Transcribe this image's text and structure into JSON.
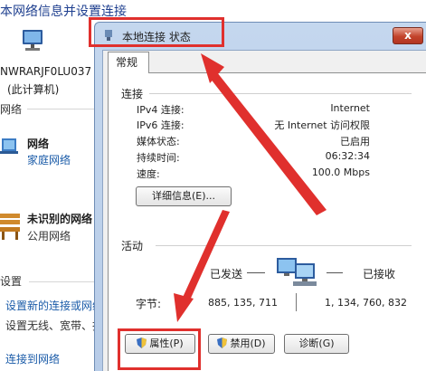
{
  "background": {
    "title": "本网络信息并设置连接",
    "computer_name": "NWRARJF0LU037",
    "computer_sub": "(此计算机)",
    "section_network": "网络",
    "networks": [
      {
        "name": "网络",
        "type_link": "家庭网络"
      },
      {
        "name": "未识别的网络",
        "type_text": "公用网络"
      }
    ],
    "section_settings": "设置",
    "links": [
      "设置新的连接或网络",
      "设置无线、宽带、拨",
      "连接到网络"
    ]
  },
  "dialog": {
    "title": "本地连接 状态",
    "close_label": "x",
    "tab": "常规",
    "connection": {
      "group_title": "连接",
      "rows": [
        {
          "label": "IPv4 连接:",
          "value": "Internet"
        },
        {
          "label": "IPv6 连接:",
          "value": "无 Internet 访问权限"
        },
        {
          "label": "媒体状态:",
          "value": "已启用"
        },
        {
          "label": "持续时间:",
          "value": "06:32:34"
        },
        {
          "label": "速度:",
          "value": "100.0 Mbps"
        }
      ],
      "details_button": "详细信息(E)..."
    },
    "activity": {
      "group_title": "活动",
      "sent_label": "已发送",
      "received_label": "已接收",
      "bytes_label": "字节:",
      "bytes_sent": "885, 135, 711",
      "bytes_received": "1, 134, 760, 832"
    },
    "buttons": {
      "properties": "属性(P)",
      "disable": "禁用(D)",
      "diagnose": "诊断(G)"
    }
  },
  "annotation_color": "#e0302d"
}
